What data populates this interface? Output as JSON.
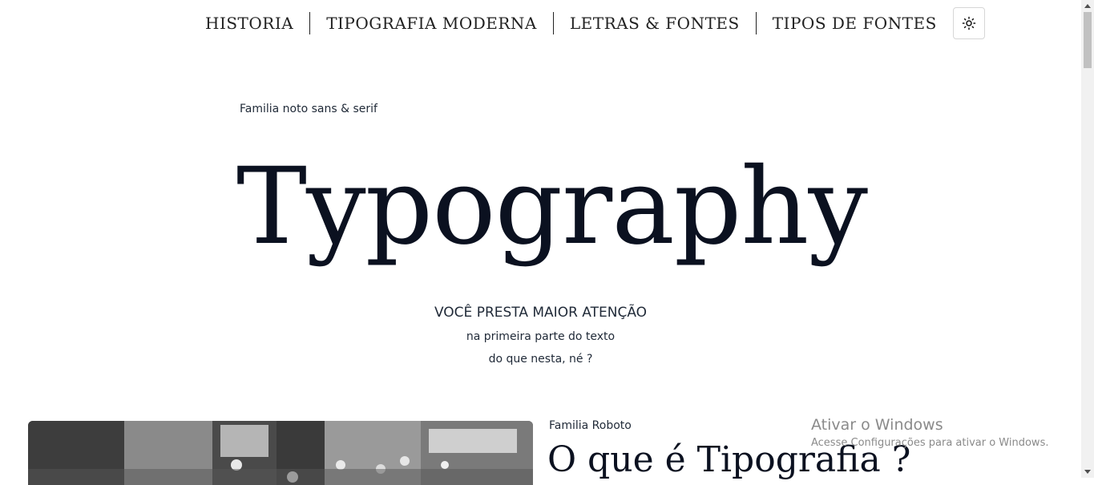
{
  "nav": {
    "items": [
      {
        "label": "HISTORIA"
      },
      {
        "label": "TIPOGRAFIA MODERNA"
      },
      {
        "label": "LETRAS & FONTES"
      },
      {
        "label": "TIPOS DE FONTES"
      }
    ],
    "theme_toggle_icon": "sun-icon"
  },
  "hero": {
    "eyebrow": "Familia noto sans & serif",
    "title": "Typography",
    "subtitle": "VOCÊ PRESTA MAIOR ATENÇÃO",
    "line1": "na primeira parte do texto",
    "line2": "do que nesta, né ?"
  },
  "section": {
    "family_label": "Familia Roboto",
    "heading": "O que é Tipografia ?"
  },
  "windows_watermark": {
    "title": "Ativar o Windows",
    "subtitle": "Acesse Configurações para ativar o Windows."
  }
}
